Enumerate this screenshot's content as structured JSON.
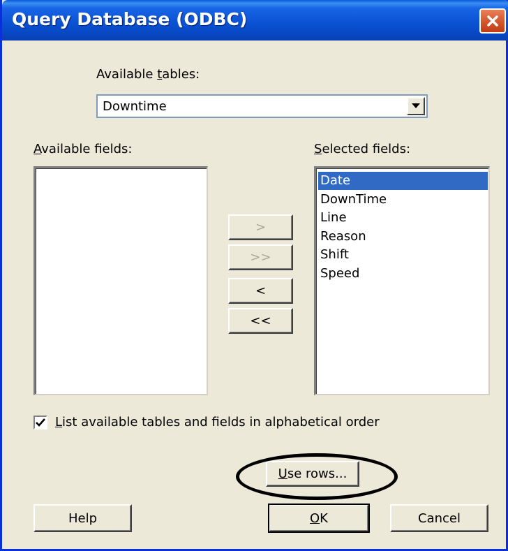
{
  "window": {
    "title": "Query Database (ODBC)"
  },
  "tables": {
    "label": "Available tables:",
    "label_pre": "Available ",
    "label_mnemonic": "t",
    "label_post": "ables:",
    "selected": "Downtime"
  },
  "available_fields": {
    "label_mnemonic": "A",
    "label_post": "vailable fields:",
    "items": []
  },
  "selected_fields": {
    "label_mnemonic": "S",
    "label_post": "elected fields:",
    "items": [
      "Date",
      "DownTime",
      "Line",
      "Reason",
      "Shift",
      "Speed"
    ],
    "highlighted": "Date"
  },
  "move_buttons": {
    "add": ">",
    "add_all": ">>",
    "remove": "<",
    "remove_all": "<<"
  },
  "alphabetical_checkbox": {
    "checked": true,
    "label_mnemonic": "L",
    "label_post": "ist available tables and fields in alphabetical order"
  },
  "buttons": {
    "use_rows_mnemonic": "U",
    "use_rows_post": "se rows...",
    "help": "Help",
    "ok_mnemonic": "O",
    "ok_post": "K",
    "cancel": "Cancel"
  },
  "colors": {
    "titlebar": "#0A53D4",
    "dialog_bg": "#ECE9D8",
    "selection": "#316AC5",
    "close_button": "#D45A30",
    "annotation_oval": "#000000"
  }
}
